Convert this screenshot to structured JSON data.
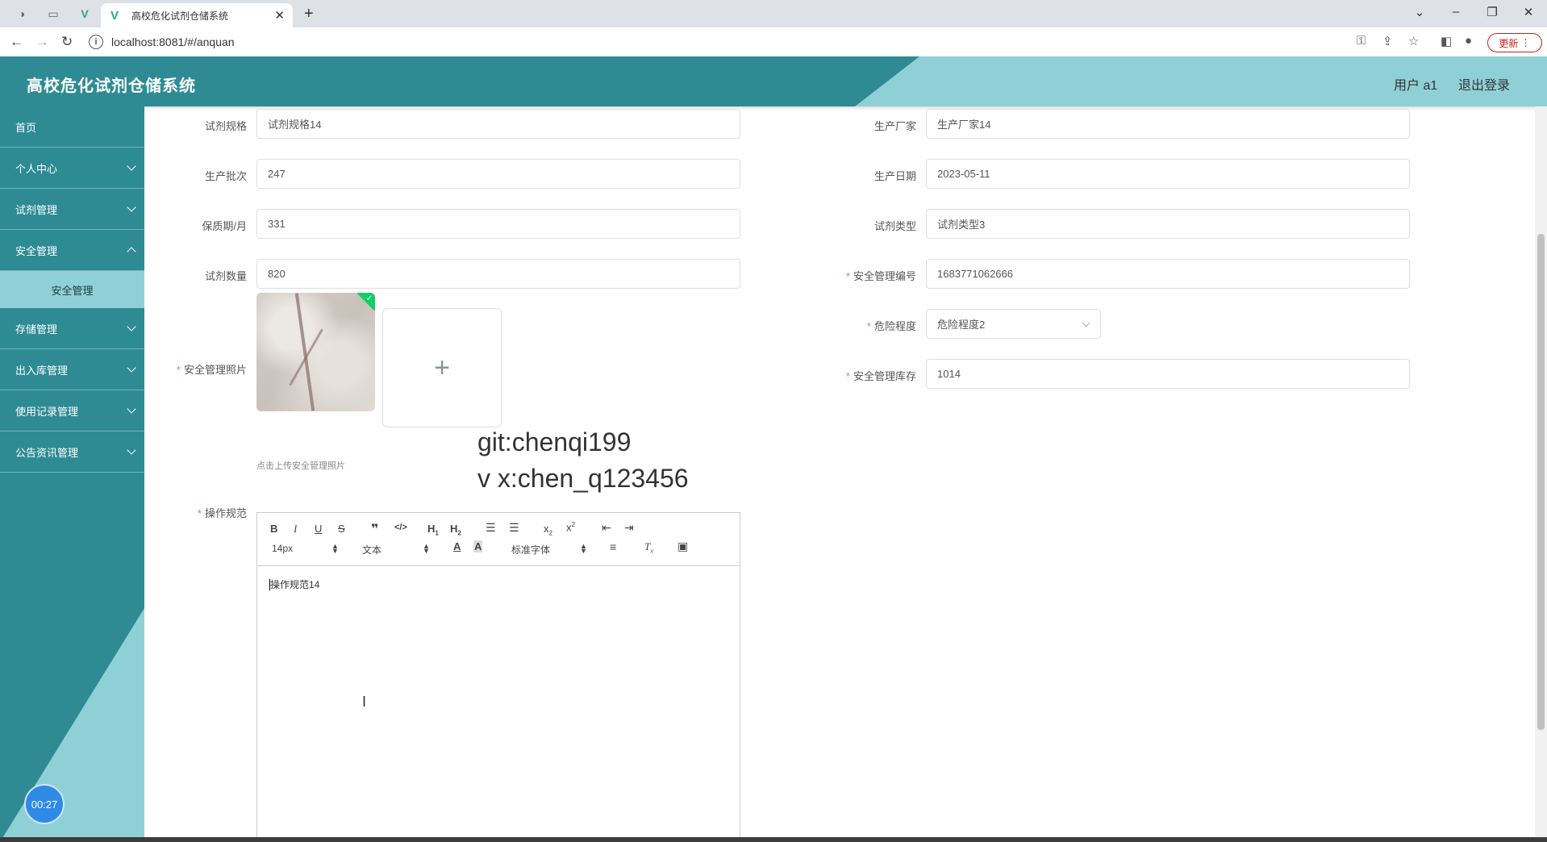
{
  "browser": {
    "tab_title": "高校危化试剂仓储系统",
    "url": "localhost:8081/#/anquan",
    "update_label": "更新"
  },
  "header": {
    "title": "高校危化试剂仓储系统",
    "user_label": "用户 a1",
    "logout_label": "退出登录"
  },
  "sidebar": {
    "items": [
      {
        "label": "首页"
      },
      {
        "label": "个人中心"
      },
      {
        "label": "试剂管理"
      },
      {
        "label": "安全管理"
      },
      {
        "label": "存储管理"
      },
      {
        "label": "出入库管理"
      },
      {
        "label": "使用记录管理"
      },
      {
        "label": "公告资讯管理"
      }
    ],
    "active_sub": "安全管理",
    "timer": "00:27"
  },
  "form": {
    "spec": {
      "label": "试剂规格",
      "value": "试剂规格14"
    },
    "maker": {
      "label": "生产厂家",
      "value": "生产厂家14"
    },
    "batch": {
      "label": "生产批次",
      "value": "247"
    },
    "date": {
      "label": "生产日期",
      "value": "2023-05-11"
    },
    "shelf": {
      "label": "保质期/月",
      "value": "331"
    },
    "type": {
      "label": "试剂类型",
      "value": "试剂类型3"
    },
    "qty": {
      "label": "试剂数量",
      "value": "820"
    },
    "code": {
      "label": "安全管理编号",
      "value": "1683771062666"
    },
    "danger": {
      "label": "危险程度",
      "value": "危险程度2"
    },
    "stock": {
      "label": "安全管理库存",
      "value": "1014"
    },
    "photo": {
      "label": "安全管理照片",
      "tip": "点击上传安全管理照片"
    },
    "rules": {
      "label": "操作规范",
      "content": "操作规范14"
    }
  },
  "editor_toolbar": {
    "font_size": "14px",
    "text_style": "文本",
    "font_family": "标准字体"
  },
  "watermark": {
    "line1": "git:chenqi199",
    "line2": "v x:chen_q123456"
  }
}
